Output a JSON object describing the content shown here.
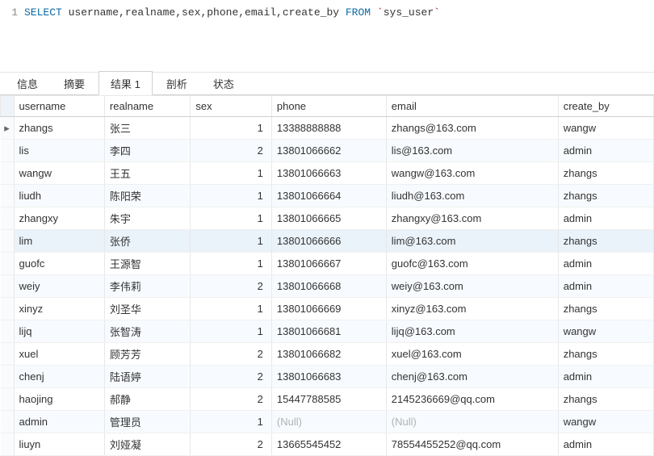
{
  "editor": {
    "line_number": "1",
    "sql_parts": {
      "select_kw": "SELECT",
      "cols": " username,realname,sex,phone,email,create_by ",
      "from_kw": "FROM",
      "space": " ",
      "backtick1": "`",
      "table": "sys_user",
      "backtick2": "`"
    }
  },
  "tabs": {
    "items": [
      {
        "label": "信息",
        "active": false
      },
      {
        "label": "摘要",
        "active": false
      },
      {
        "label": "结果 1",
        "active": true
      },
      {
        "label": "剖析",
        "active": false
      },
      {
        "label": "状态",
        "active": false
      }
    ]
  },
  "table": {
    "columns": [
      "username",
      "realname",
      "sex",
      "phone",
      "email",
      "create_by"
    ],
    "rows": [
      {
        "mark": "▸",
        "username": "zhangs",
        "realname": "张三",
        "sex": "1",
        "phone": "13388888888",
        "email": "zhangs@163.com",
        "create_by": "wangw",
        "hl": false
      },
      {
        "mark": "",
        "username": "lis",
        "realname": "李四",
        "sex": "2",
        "phone": "13801066662",
        "email": "lis@163.com",
        "create_by": "admin",
        "hl": false
      },
      {
        "mark": "",
        "username": "wangw",
        "realname": "王五",
        "sex": "1",
        "phone": "13801066663",
        "email": "wangw@163.com",
        "create_by": "zhangs",
        "hl": false
      },
      {
        "mark": "",
        "username": "liudh",
        "realname": "陈阳荣",
        "sex": "1",
        "phone": "13801066664",
        "email": "liudh@163.com",
        "create_by": "zhangs",
        "hl": false
      },
      {
        "mark": "",
        "username": "zhangxy",
        "realname": "朱宇",
        "sex": "1",
        "phone": "13801066665",
        "email": "zhangxy@163.com",
        "create_by": "admin",
        "hl": false
      },
      {
        "mark": "",
        "username": "lim",
        "realname": "张侨",
        "sex": "1",
        "phone": "13801066666",
        "email": "lim@163.com",
        "create_by": "zhangs",
        "hl": true
      },
      {
        "mark": "",
        "username": "guofc",
        "realname": "王源智",
        "sex": "1",
        "phone": "13801066667",
        "email": "guofc@163.com",
        "create_by": "admin",
        "hl": false
      },
      {
        "mark": "",
        "username": "weiy",
        "realname": "李伟莉",
        "sex": "2",
        "phone": "13801066668",
        "email": "weiy@163.com",
        "create_by": "admin",
        "hl": false
      },
      {
        "mark": "",
        "username": "xinyz",
        "realname": "刘圣华",
        "sex": "1",
        "phone": "13801066669",
        "email": "xinyz@163.com",
        "create_by": "zhangs",
        "hl": false
      },
      {
        "mark": "",
        "username": "lijq",
        "realname": "张智涛",
        "sex": "1",
        "phone": "13801066681",
        "email": "lijq@163.com",
        "create_by": "wangw",
        "hl": false
      },
      {
        "mark": "",
        "username": "xuel",
        "realname": "顾芳芳",
        "sex": "2",
        "phone": "13801066682",
        "email": "xuel@163.com",
        "create_by": "zhangs",
        "hl": false
      },
      {
        "mark": "",
        "username": "chenj",
        "realname": "陆语婷",
        "sex": "2",
        "phone": "13801066683",
        "email": "chenj@163.com",
        "create_by": "admin",
        "hl": false
      },
      {
        "mark": "",
        "username": "haojing",
        "realname": "郝静",
        "sex": "2",
        "phone": "15447788585",
        "email": "2145236669@qq.com",
        "create_by": "zhangs",
        "hl": false
      },
      {
        "mark": "",
        "username": "admin",
        "realname": "管理员",
        "sex": "1",
        "phone": "(Null)",
        "phone_null": true,
        "email": "(Null)",
        "email_null": true,
        "create_by": "wangw",
        "hl": false
      },
      {
        "mark": "",
        "username": "liuyn",
        "realname": "刘娅凝",
        "sex": "2",
        "phone": "13665545452",
        "email": "78554455252@qq.com",
        "create_by": "admin",
        "hl": false
      }
    ]
  }
}
